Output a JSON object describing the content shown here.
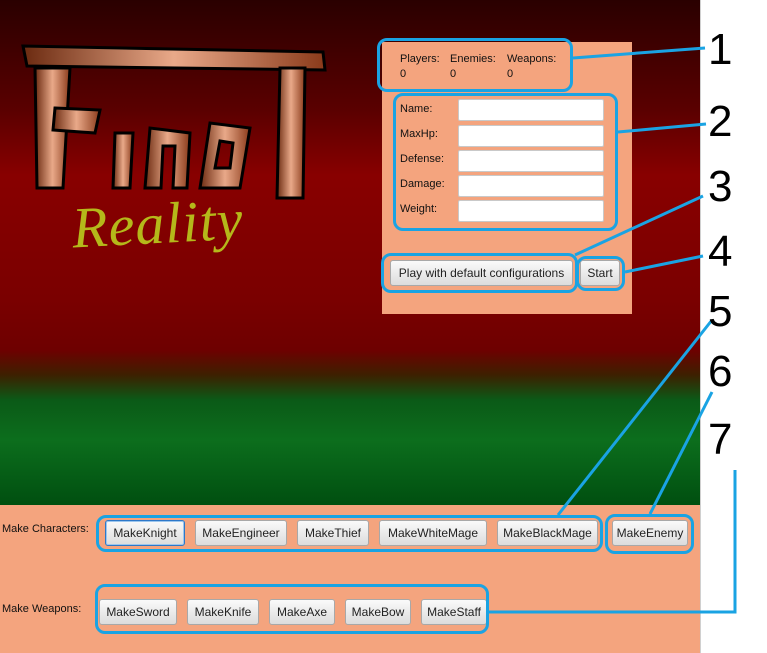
{
  "logo": {
    "title": "Final",
    "subtitle": "Reality"
  },
  "stats": {
    "players_label": "Players:",
    "players_value": "0",
    "enemies_label": "Enemies:",
    "enemies_value": "0",
    "weapons_label": "Weapons:",
    "weapons_value": "0"
  },
  "form": {
    "name_label": "Name:",
    "maxhp_label": "MaxHp:",
    "defense_label": "Defense:",
    "damage_label": "Damage:",
    "weight_label": "Weight:",
    "name_value": "",
    "maxhp_value": "",
    "defense_value": "",
    "damage_value": "",
    "weight_value": ""
  },
  "actions": {
    "default_label": "Play with default configurations",
    "start_label": "Start"
  },
  "characters": {
    "label": "Make Characters:",
    "buttons": [
      "MakeKnight",
      "MakeEngineer",
      "MakeThief",
      "MakeWhiteMage",
      "MakeBlackMage"
    ],
    "enemy_button": "MakeEnemy"
  },
  "weapons": {
    "label": "Make Weapons:",
    "buttons": [
      "MakeSword",
      "MakeKnife",
      "MakeAxe",
      "MakeBow",
      "MakeStaff"
    ]
  },
  "annotations": [
    "1",
    "2",
    "3",
    "4",
    "5",
    "6",
    "7"
  ],
  "colors": {
    "annotation": "#1aa3e3",
    "panel": "#f4a47e",
    "logo_subtitle": "#b5b81a"
  }
}
